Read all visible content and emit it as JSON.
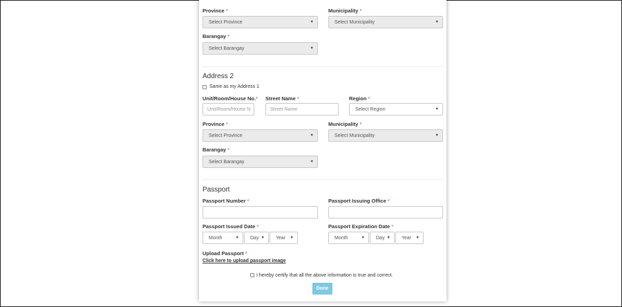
{
  "address1": {
    "province_label": "Province",
    "province_placeholder": "Select Province",
    "municipality_label": "Municipality",
    "municipality_placeholder": "Select Municipality",
    "barangay_label": "Barangay",
    "barangay_placeholder": "Select Barangay"
  },
  "address2": {
    "title": "Address 2",
    "same_as_label": "Same as my Address 1",
    "unit_label": "Unit/Room/House No.",
    "unit_placeholder": "Unit/Room/House N",
    "street_label": "Street Name",
    "street_placeholder": "Street Name",
    "region_label": "Region",
    "region_placeholder": "Select Region",
    "province_label": "Province",
    "province_placeholder": "Select Province",
    "municipality_label": "Municipality",
    "municipality_placeholder": "Select Municipality",
    "barangay_label": "Barangay",
    "barangay_placeholder": "Select Barangay"
  },
  "passport": {
    "title": "Passport",
    "number_label": "Passport Number",
    "issuing_office_label": "Passport Issuing Office",
    "issued_date_label": "Passport Issued Date",
    "expiration_date_label": "Passport Expiration Date",
    "month_label": "Month",
    "day_label": "Day",
    "year_label": "Year",
    "upload_label": "Upload Passport",
    "upload_link": "Click here to upload passport image"
  },
  "required_mark": "*",
  "caret": "▼",
  "certify_text": "I hereby certify that all the above information is true and correct.",
  "done_label": "Done",
  "colors": {
    "required": "#c0392b",
    "button": "#7ec8e3",
    "disabled_field": "#ebebeb"
  }
}
